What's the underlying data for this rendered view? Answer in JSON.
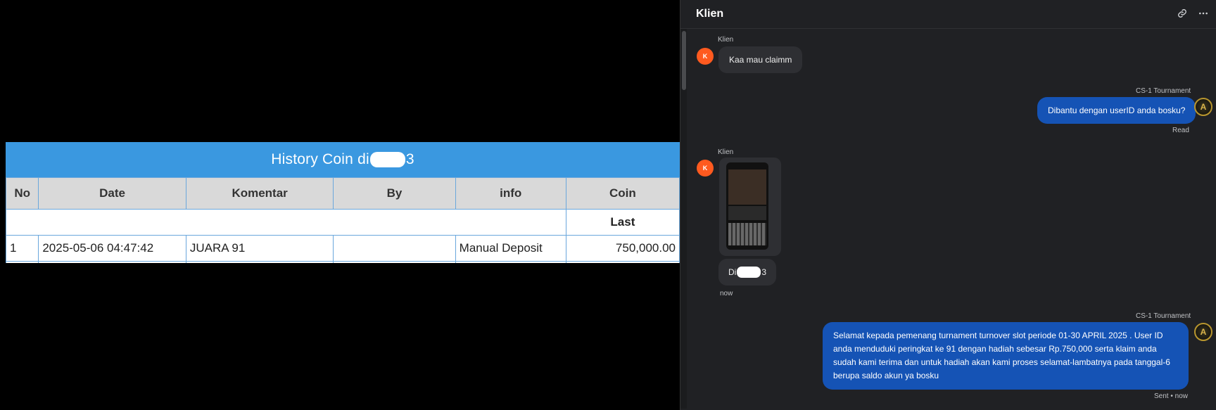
{
  "history_table": {
    "title_prefix": "History Coin di",
    "title_suffix": "3",
    "headers": [
      "No",
      "Date",
      "Komentar",
      "By",
      "info",
      "Coin"
    ],
    "subheader_last": "Last",
    "rows": [
      {
        "no": "1",
        "date": "2025-05-06 04:47:42",
        "komentar": "JUARA 91",
        "by": "",
        "info": "Manual Deposit",
        "coin": "750,000.00"
      }
    ]
  },
  "chat": {
    "title": "Klien",
    "link_icon": "link-icon",
    "more_icon": "more-icon",
    "messages": [
      {
        "sender": "Klien",
        "avatar": "K",
        "text": "Kaa mau claimm"
      },
      {
        "sender": "CS-1 Tournament",
        "avatar": "A",
        "text": "Dibantu dengan userID anda bosku?",
        "status": "Read"
      },
      {
        "sender": "Klien",
        "avatar": "K",
        "attachment": "image",
        "text_prefix": "Di",
        "text_suffix": "3",
        "time": "now"
      },
      {
        "sender": "CS-1 Tournament",
        "avatar": "A",
        "text": "Selamat kepada pemenang turnament turnover slot periode 01-30 APRIL 2025 . User ID anda menduduki peringkat ke 91 dengan hadiah sebesar Rp.750,000 serta klaim anda sudah kami terima dan untuk hadiah akan kami proses selamat-lambatnya pada tanggal-6 berupa saldo akun ya bosku",
        "status": "Sent • now"
      }
    ]
  }
}
